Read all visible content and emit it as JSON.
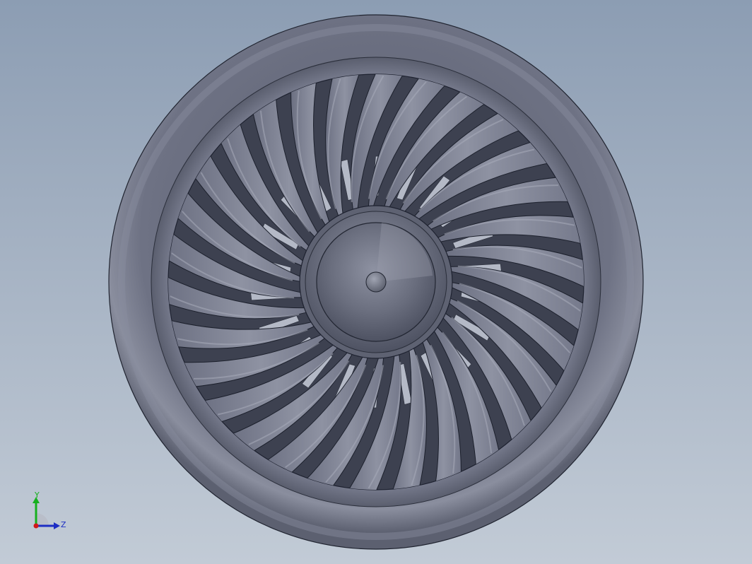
{
  "viewport": {
    "model_name": "",
    "fan_blade_count": 30,
    "colors": {
      "background_top": "#8c9db3",
      "background_bottom": "#c2cbd6",
      "nacelle": "#6d7183",
      "blade": "#7c8092",
      "spinner": "#6a6e7e",
      "cavity": "#3a3e4c",
      "highlight": "#b8bdc8"
    }
  },
  "triad": {
    "y_label": "Y",
    "z_label": "Z",
    "y_color": "#16b01e",
    "z_color": "#1d2ec4",
    "x_color": "#d01818"
  }
}
